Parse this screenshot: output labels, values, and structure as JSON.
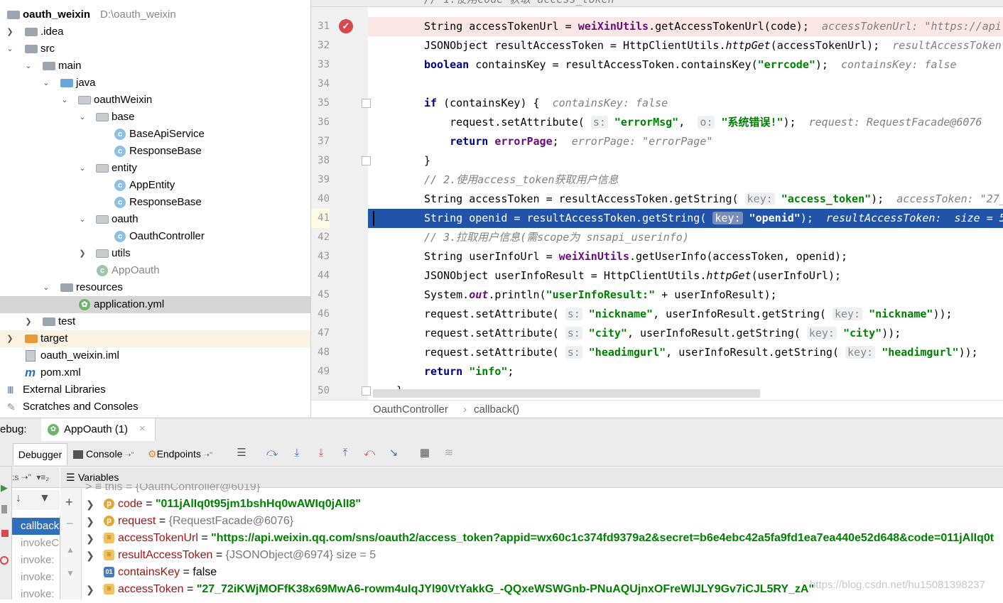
{
  "project": {
    "name": "oauth_weixin",
    "path": "D:\\oauth_weixin",
    "tree": [
      {
        "label": ".idea"
      },
      {
        "label": "src"
      },
      {
        "label": "main"
      },
      {
        "label": "java"
      },
      {
        "label": "oauthWeixin"
      },
      {
        "label": "base"
      },
      {
        "label": "BaseApiService"
      },
      {
        "label": "ResponseBase"
      },
      {
        "label": "entity"
      },
      {
        "label": "AppEntity"
      },
      {
        "label": "ResponseBase"
      },
      {
        "label": "oauth"
      },
      {
        "label": "OauthController"
      },
      {
        "label": "utils"
      },
      {
        "label": "AppOauth"
      },
      {
        "label": "resources"
      },
      {
        "label": "application.yml"
      },
      {
        "label": "test"
      },
      {
        "label": "target"
      },
      {
        "label": "oauth_weixin.iml"
      },
      {
        "label": "pom.xml"
      },
      {
        "label": "External Libraries"
      },
      {
        "label": "Scratches and Consoles"
      }
    ]
  },
  "editor": {
    "line_numbers": [
      "31",
      "32",
      "33",
      "34",
      "35",
      "36",
      "37",
      "38",
      "39",
      "40",
      "41",
      "42",
      "43",
      "44",
      "45",
      "46",
      "47",
      "48",
      "49",
      "50"
    ],
    "breadcrumb": {
      "class": "OauthController",
      "method": "callback()"
    }
  },
  "debug": {
    "label": "ebug:",
    "session": "AppOauth (1)",
    "tabs": {
      "debugger": "Debugger",
      "console": "Console",
      "endpoints": "Endpoints"
    },
    "variables_header": "Variables",
    "frames": [
      "callback",
      "invokeC",
      "invoke:",
      "invoke:",
      "invoke:"
    ],
    "variables": [
      {
        "name": "code",
        "value": "\"011jAlIq0t95jm1bshHq0wAWIq0jAlI8\"",
        "kind": "p"
      },
      {
        "name": "request",
        "value": "{RequestFacade@6076}",
        "kind": "p"
      },
      {
        "name": "accessTokenUrl",
        "value": "\"https://api.weixin.qq.com/sns/oauth2/access_token?appid=wx60c1c374fd9379a2&secret=b6e4ebc42a5fa9fd1ea7ea440e52d648&code=011jAlIq0t",
        "kind": "list"
      },
      {
        "name": "resultAccessToken",
        "value": "{JSONObject@6974}  size = 5",
        "kind": "list"
      },
      {
        "name": "containsKey",
        "value": "false",
        "kind": "01"
      },
      {
        "name": "accessToken",
        "value": "\"27_72iKWjMOFfK38x69MwA6-rowm4uIqJYl90VtYakkG_-QQxeWSWGnb-PNuAQUjnxOFreWlJLY9Gv7iCJL5RY_zA\"",
        "kind": "list"
      }
    ],
    "watermark": "https://blog.csdn.net/hu15081398237"
  },
  "colors": {
    "current_line": "#2154a8",
    "breakpoint_line": "#fbe6e6",
    "string": "#008000",
    "keyword": "#000080"
  }
}
